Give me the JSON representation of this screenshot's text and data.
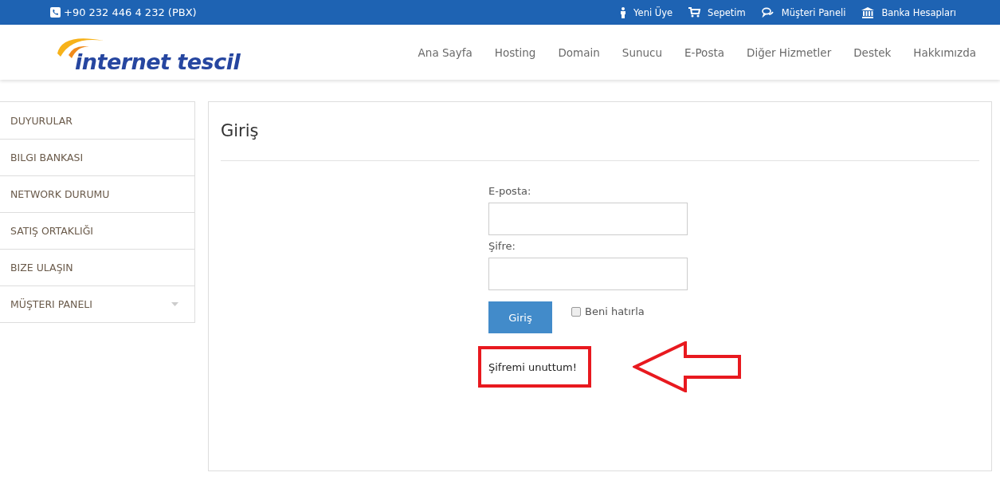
{
  "topbar": {
    "phone": "+90 232 446 4 232 (PBX)",
    "links": [
      {
        "kind": "member",
        "label": "Yeni Üye"
      },
      {
        "kind": "cart",
        "label": "Sepetim"
      },
      {
        "kind": "panel",
        "label": "Müşteri Paneli"
      },
      {
        "kind": "bank",
        "label": "Banka Hesapları"
      }
    ]
  },
  "logo": {
    "text": "internet tescil"
  },
  "nav": [
    "Ana Sayfa",
    "Hosting",
    "Domain",
    "Sunucu",
    "E-Posta",
    "Diğer Hizmetler",
    "Destek",
    "Hakkımızda"
  ],
  "sidebar": {
    "items": [
      {
        "label": "DUYURULAR",
        "submenu": false
      },
      {
        "label": "BILGI BANKASI",
        "submenu": false
      },
      {
        "label": "NETWORK DURUMU",
        "submenu": false
      },
      {
        "label": "SATIŞ ORTAKLIĞI",
        "submenu": false
      },
      {
        "label": "BIZE ULAŞIN",
        "submenu": false
      },
      {
        "label": "MÜŞTERI PANELI",
        "submenu": true
      }
    ]
  },
  "login": {
    "title": "Giriş",
    "fields": [
      {
        "label": "E-posta:"
      },
      {
        "label": "Şifre:"
      }
    ],
    "submit": "Giriş",
    "remember": {
      "label": "Beni hatırla",
      "checked": false
    },
    "forgot": {
      "label": "Şifremi unuttum!",
      "highlighted": true
    }
  }
}
